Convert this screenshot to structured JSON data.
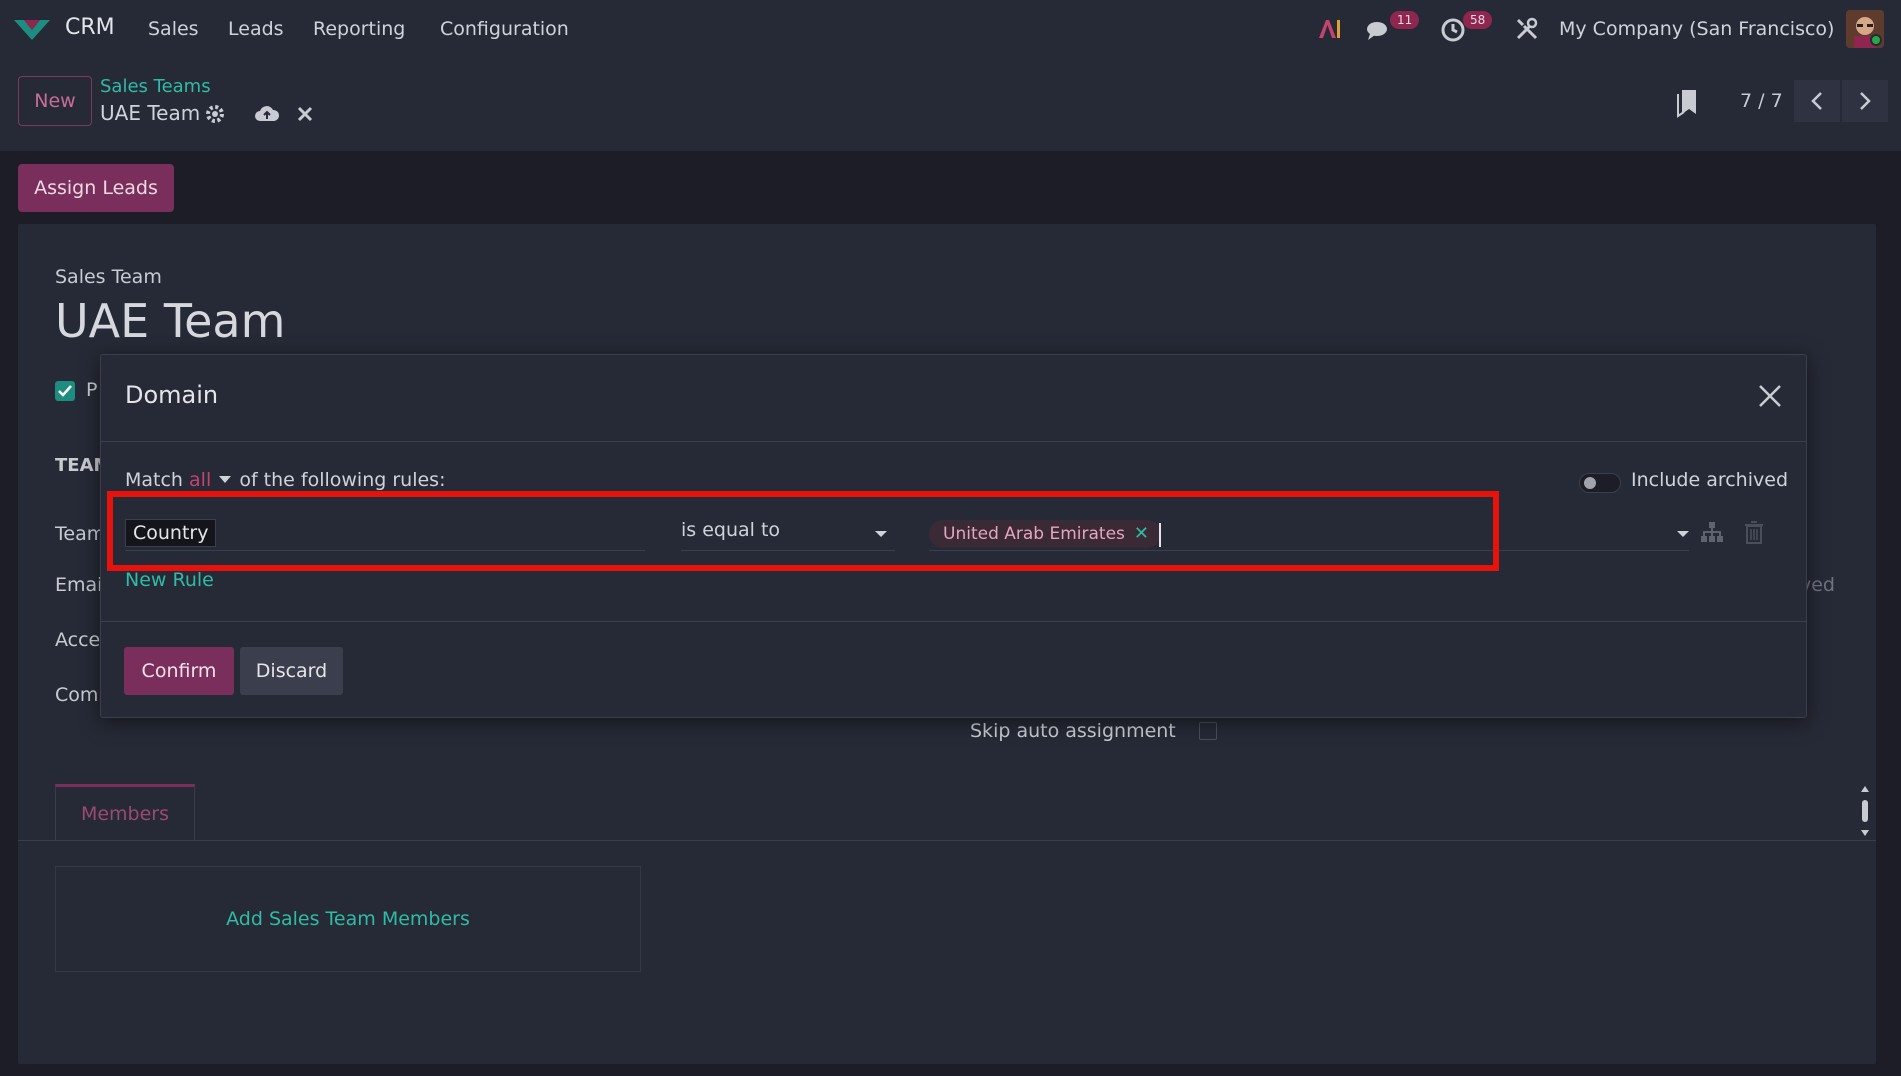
{
  "navbar": {
    "app_name": "CRM",
    "menus": [
      "Sales",
      "Leads",
      "Reporting",
      "Configuration"
    ],
    "messages_count": "11",
    "activities_count": "58",
    "company": "My Company (San Francisco)",
    "icons": [
      "ai-icon",
      "chat-icon",
      "clock-icon",
      "tools-icon"
    ]
  },
  "control": {
    "new_label": "New",
    "breadcrumb_parent": "Sales Teams",
    "breadcrumb_current": "UAE Team",
    "pager": "7 / 7"
  },
  "buttons": {
    "assign_leads": "Assign Leads"
  },
  "form": {
    "label": "Sales Team",
    "title": "UAE Team",
    "checkbox_label_partial": "P",
    "section_partial": "TEAM",
    "field_labels_partial": [
      "Team",
      "Emai",
      "Acce",
      "Com"
    ],
    "right_partial": "ved",
    "skip_auto_assignment": "Skip auto assignment",
    "members_tab": "Members",
    "add_members": "Add Sales Team Members"
  },
  "modal": {
    "title": "Domain",
    "match_prefix": "Match",
    "match_value": "all",
    "match_suffix": "of the following rules:",
    "include_archived": "Include archived",
    "include_archived_on": false,
    "rule": {
      "field": "Country",
      "operator": "is equal to",
      "value_tag": "United Arab Emirates"
    },
    "new_rule": "New Rule",
    "confirm": "Confirm",
    "discard": "Discard"
  },
  "colors": {
    "accent": "#7a2e5c",
    "teal": "#2fbba6",
    "highlight": "#e8120c",
    "background": "#1c1d26",
    "surface": "#262a36"
  }
}
